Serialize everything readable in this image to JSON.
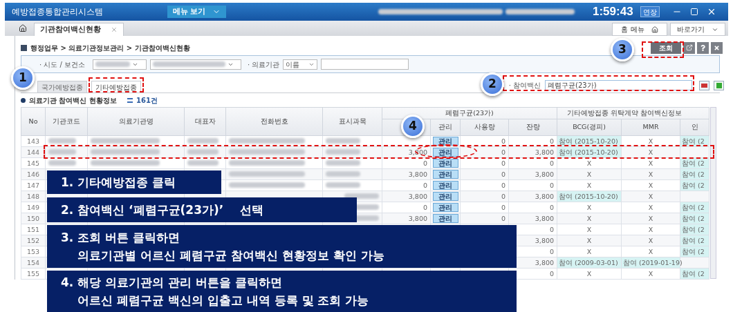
{
  "title_bar": {
    "app_title": "예방접종통합관리시스템",
    "menu_button": "메뉴 보기",
    "session_time": "1:59:43",
    "extend_button": "연장"
  },
  "tab_bar": {
    "tabs": [
      {
        "label": "기관참여백신현황",
        "selected": true
      }
    ],
    "shortcuts": [
      "홈 메뉴",
      "바로가기"
    ]
  },
  "breadcrumb": "행정업무 > 의료기관정보관리 > 기관참여백신현황",
  "toolbar": {
    "search_button": "조회"
  },
  "filters": {
    "region_label": "· 시도 / 보건소",
    "institution_label": "· 의료기관",
    "institution_type": "이름"
  },
  "sub_tabs": [
    {
      "label": "국가예방접종",
      "selected": false
    },
    {
      "label": "기타예방접종",
      "selected": true
    }
  ],
  "vaccine_filter": {
    "label": "· 참여백신",
    "value": "폐렴구균(23가)"
  },
  "section": {
    "title": "의료기관 참여백신 현황정보",
    "count": "161건"
  },
  "table": {
    "header_groups": [
      "폐렴구균(23가)",
      "기타예방접종 위탁계약 참여백신정보"
    ],
    "columns": [
      "No",
      "기관코드",
      "의료기관명",
      "대표자",
      "전화번호",
      "표시과목",
      null,
      "관리",
      "사용량",
      "잔량",
      "BCG(경피)",
      "MMR",
      "인"
    ],
    "rows": [
      {
        "no": "143",
        "kind": "blurred",
        "stock": null,
        "manage": "관리",
        "used": "0",
        "remain": "0",
        "bcg": {
          "text": "참여 (2015-10-20)",
          "joined": true
        },
        "mmr": {
          "text": "X",
          "joined": false
        },
        "other": {
          "text": "참여 (2",
          "joined": true
        }
      },
      {
        "no": "144",
        "kind": "blurred",
        "stock": "3,800",
        "manage": "관리",
        "used": "0",
        "remain": "3,800",
        "bcg": {
          "text": "참여 (2015-10-20)",
          "joined": true
        },
        "mmr": {
          "text": "X",
          "joined": false
        },
        "other": {
          "joined": false
        }
      },
      {
        "no": "145",
        "kind": "blurred",
        "stock": "0",
        "manage": "관리",
        "used": "0",
        "remain": "0",
        "bcg": {
          "text": "X",
          "joined": false
        },
        "mmr": {
          "text": "X",
          "joined": false
        },
        "other": {
          "text": "참여 (2",
          "joined": true
        }
      },
      {
        "no": "146",
        "kind": "phone",
        "stock": "3,800",
        "manage": "관리",
        "used": "0",
        "remain": "3,800",
        "bcg": {
          "text": "X",
          "joined": false
        },
        "mmr": {
          "text": "X",
          "joined": false
        },
        "other": {
          "text": "참여 (2",
          "joined": true
        }
      },
      {
        "no": "147",
        "kind": "phone",
        "stock": "0",
        "manage": "관리",
        "used": "0",
        "remain": "0",
        "bcg": {
          "text": "X",
          "joined": false
        },
        "mmr": {
          "text": "X",
          "joined": false
        },
        "other": {
          "text": "참여 (2",
          "joined": true
        }
      },
      {
        "no": "148",
        "kind": "subject",
        "stock": "3,800",
        "manage": "관리",
        "used": "0",
        "remain": "3,800",
        "bcg": {
          "text": "참여 (2015-10-20)",
          "joined": true
        },
        "mmr": {
          "text": "X",
          "joined": false
        },
        "other": {
          "joined": false
        }
      },
      {
        "no": "149",
        "kind": "subject",
        "stock": "0",
        "manage": "관리",
        "used": "0",
        "remain": "0",
        "bcg": {
          "text": "X",
          "joined": false
        },
        "mmr": {
          "text": "X",
          "joined": false
        },
        "other": {
          "text": "참여 (2",
          "joined": true
        }
      },
      {
        "no": "150",
        "kind": "subject",
        "stock": "3,800",
        "manage": "관리",
        "used": "0",
        "remain": "3,800",
        "bcg": {
          "text": "X",
          "joined": false
        },
        "mmr": {
          "text": "X",
          "joined": false
        },
        "other": {
          "text": "참여 (2",
          "joined": true
        }
      },
      {
        "no": "151",
        "kind": "plain",
        "stock": null,
        "manage": null,
        "used": null,
        "remain": "0",
        "bcg": {
          "text": "X",
          "joined": false
        },
        "mmr": {
          "text": "X",
          "joined": false
        },
        "other": {
          "text": "참여 (2",
          "joined": true
        }
      },
      {
        "no": "152",
        "kind": "plain",
        "stock": null,
        "manage": null,
        "used": null,
        "remain": "3,800",
        "bcg": {
          "text": "X",
          "joined": false
        },
        "mmr": {
          "text": "X",
          "joined": false
        },
        "other": {
          "text": "참여 (2",
          "joined": true
        }
      },
      {
        "no": "153",
        "kind": "plain",
        "stock": null,
        "manage": null,
        "used": null,
        "remain": "0",
        "bcg": {
          "text": "X",
          "joined": false
        },
        "mmr": {
          "text": "X",
          "joined": false
        },
        "other": {
          "text": "참여 (2",
          "joined": true
        }
      },
      {
        "no": "154",
        "kind": "plain",
        "stock": null,
        "manage": null,
        "used": null,
        "remain": "3,800",
        "bcg": {
          "text": "참여 (2009-03-01)",
          "joined": true
        },
        "mmr": {
          "text": "참여 (2019-01-19)",
          "joined": true
        },
        "other": {
          "joined": false
        }
      },
      {
        "no": "155",
        "kind": "plain",
        "stock": null,
        "manage": null,
        "used": null,
        "remain": "0",
        "bcg": {
          "text": "X",
          "joined": false
        },
        "mmr": {
          "text": "X",
          "joined": false
        },
        "other": {
          "text": "참여 (2",
          "joined": true
        }
      }
    ]
  },
  "callouts": [
    "1",
    "2",
    "3",
    "4"
  ],
  "instructions": [
    {
      "lines": [
        "1. 기타예방접종 클릭"
      ]
    },
    {
      "lines": [
        "2. 참여백신 ‘폐렴구균(23가)’    선택"
      ]
    },
    {
      "lines": [
        "3. 조회 버튼 클릭하면",
        "의료기관별 어르신 폐렴구균 참여백신 현황정보 확인 가능"
      ]
    },
    {
      "lines": [
        "4. 해당 의료기관의 관리 버튼을 클릭하면",
        "어르신 폐렴구균 백신의 입출고 내역 등록 및 조회 가능"
      ]
    }
  ]
}
